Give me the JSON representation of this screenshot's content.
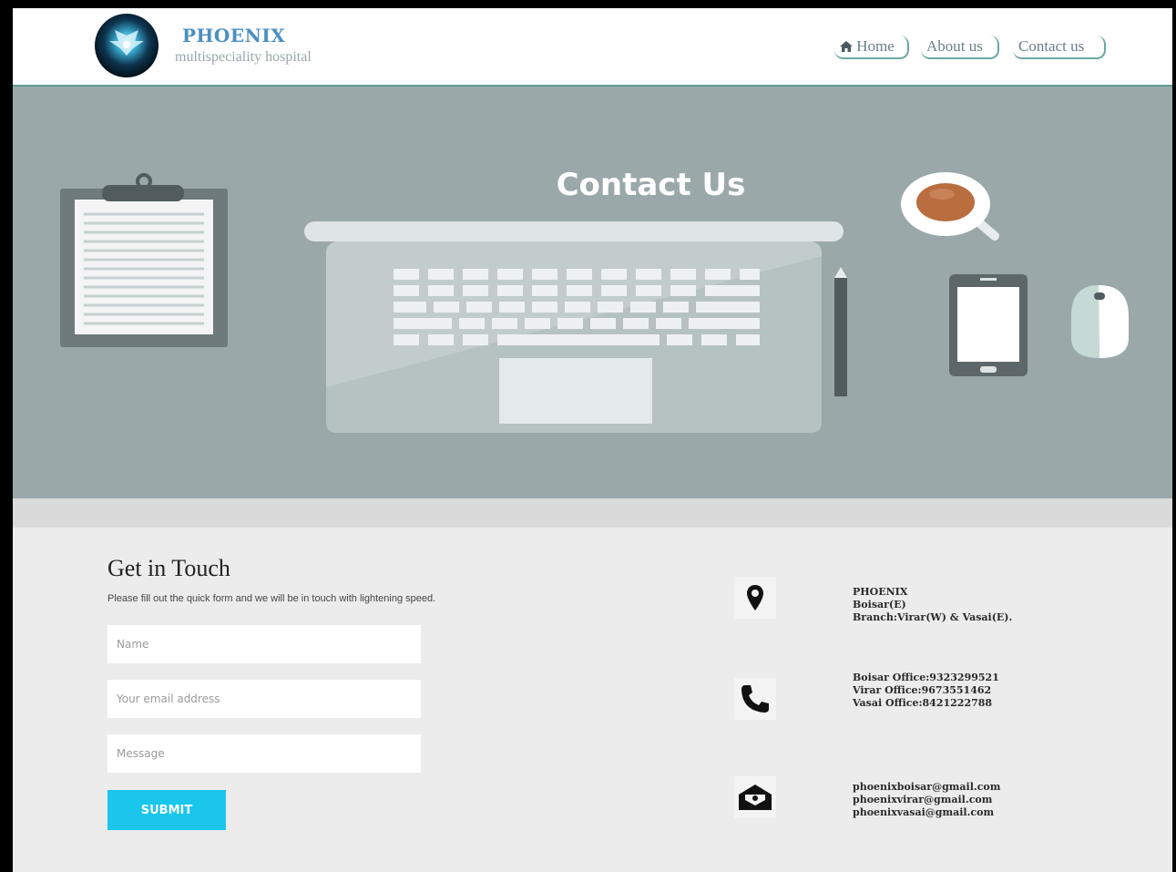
{
  "header": {
    "brand_name": "PHOENIX",
    "brand_sub": "multispeciality hospital",
    "nav": [
      {
        "label": "Home",
        "icon": "home-icon"
      },
      {
        "label": "About us"
      },
      {
        "label": "Contact us"
      }
    ]
  },
  "hero": {
    "title": "Contact Us"
  },
  "contact": {
    "title": "Get in Touch",
    "description": "Please fill out the quick form and we will be in touch with lightening speed.",
    "name_placeholder": "Name",
    "email_placeholder": "Your email address",
    "message_placeholder": "Message",
    "submit_label": "SUBMIT",
    "address": [
      "PHOENIX",
      "Boisar(E)",
      "Branch:Virar(W) & Vasai(E)."
    ],
    "phones": [
      "Boisar Office:9323299521",
      "Virar Office:9673551462",
      "Vasai Office:8421222788"
    ],
    "emails": [
      "phoenixboisar@gmail.com",
      "phoenixvirar@gmail.com",
      "phoenixvasai@gmail.com"
    ]
  },
  "colors": {
    "accent": "#1ac6ec",
    "brand": "#4a8fc4",
    "hero_bg": "#9ba8aa",
    "header_border": "#5e9e98"
  }
}
